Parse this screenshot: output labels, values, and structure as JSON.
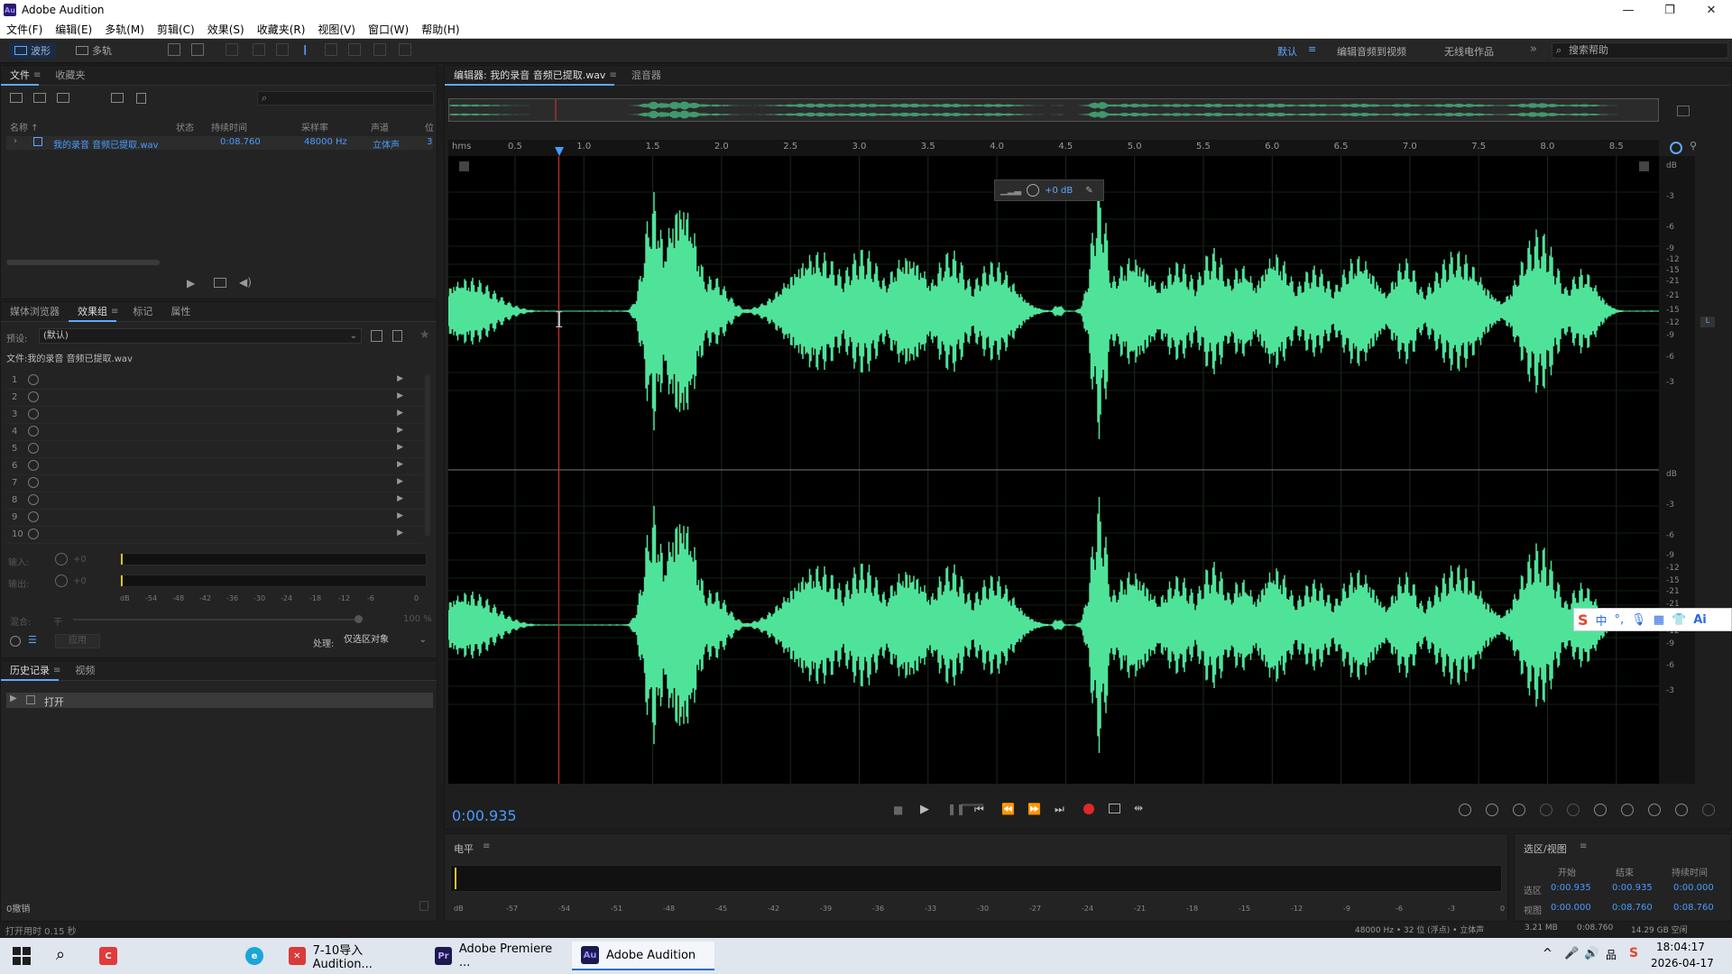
{
  "app": {
    "title": "Adobe Audition",
    "logo_text": "Au"
  },
  "menu": [
    "文件(F)",
    "编辑(E)",
    "多轨(M)",
    "剪辑(C)",
    "效果(S)",
    "收藏夹(R)",
    "视图(V)",
    "窗口(W)",
    "帮助(H)"
  ],
  "toolbar": {
    "waveform_label": "波形",
    "multitrack_label": "多轨",
    "workspaces": [
      "默认",
      "编辑音频到视频",
      "无线电作品"
    ],
    "active_workspace": "默认",
    "search_placeholder": "搜索帮助"
  },
  "files_panel": {
    "tabs": [
      "文件",
      "收藏夹"
    ],
    "columns": [
      "名称 ↑",
      "状态",
      "持续时间",
      "采样率",
      "声道",
      "位"
    ],
    "rows": [
      {
        "name": "我的录音 音频已提取.wav",
        "duration": "0:08.760",
        "sample_rate": "48000 Hz",
        "channels": "立体声",
        "bits": "3"
      }
    ]
  },
  "effects_panel": {
    "tabs": [
      "媒体浏览器",
      "效果组",
      "标记",
      "属性"
    ],
    "preset_label": "预设:",
    "preset_value": "(默认)",
    "file_label": "文件:我的录音 音频已提取.wav",
    "slots": [
      "1",
      "2",
      "3",
      "4",
      "5",
      "6",
      "7",
      "8",
      "9",
      "10"
    ],
    "input_label": "输入:",
    "output_label": "输出:",
    "gain_db": "+0",
    "meter_ticks": [
      "dB",
      "-54",
      "-48",
      "-42",
      "-36",
      "-30",
      "-24",
      "-18",
      "-12",
      "-6",
      "0"
    ],
    "mix_label": "混合:",
    "mix_dry": "干",
    "mix_wet": "100 %",
    "apply_label": "应用",
    "process_label": "处理:",
    "process_value": "仅选区对象"
  },
  "history_panel": {
    "tabs": [
      "历史记录",
      "视频"
    ],
    "items": [
      "打开"
    ],
    "undo_text": "0撤销",
    "status_text": "打开用时 0.15 秒"
  },
  "editor": {
    "tabs": [
      "编辑器: 我的录音 音频已提取.wav",
      "混音器"
    ],
    "time_unit": "hms",
    "ruler_ticks": [
      "0.5",
      "1.0",
      "1.5",
      "2.0",
      "2.5",
      "3.0",
      "3.5",
      "4.0",
      "4.5",
      "5.0",
      "5.5",
      "6.0",
      "6.5",
      "7.0",
      "7.5",
      "8.0",
      "8.5"
    ],
    "db_scale": [
      "dB",
      "-3",
      "-6",
      "-9",
      "-12",
      "-15",
      "-21",
      "-21",
      "-15",
      "-12",
      "-9",
      "-6",
      "-3"
    ],
    "hud_gain": "+0 dB",
    "current_time": "0:00.935",
    "waveform_color": "#4fe39a",
    "playhead_color": "#e03030"
  },
  "levels_panel": {
    "title": "电平",
    "ticks": [
      "dB",
      "-57",
      "-54",
      "-51",
      "-48",
      "-45",
      "-42",
      "-39",
      "-36",
      "-33",
      "-30",
      "-27",
      "-24",
      "-21",
      "-18",
      "-15",
      "-12",
      "-9",
      "-6",
      "-3",
      "0"
    ]
  },
  "selection_panel": {
    "title": "选区/视图",
    "headers": [
      "开始",
      "结束",
      "持续时间"
    ],
    "selection": {
      "label": "选区",
      "start": "0:00.935",
      "end": "0:00.935",
      "duration": "0:00.000"
    },
    "view": {
      "label": "视图",
      "start": "0:00.000",
      "end": "0:08.760",
      "duration": "0:08.760"
    }
  },
  "statusbar": {
    "format": "48000 Hz • 32 位 (浮点) • 立体声",
    "size": "3.21 MB",
    "duration": "0:08.760",
    "free": "14.29 GB 空闲"
  },
  "ime": {
    "label": "中"
  },
  "taskbar": {
    "tasks": [
      "7-10导入Audition...",
      "Adobe Premiere ...",
      "Adobe Audition"
    ],
    "time": "18:04:17",
    "date": "2026-04-17"
  }
}
